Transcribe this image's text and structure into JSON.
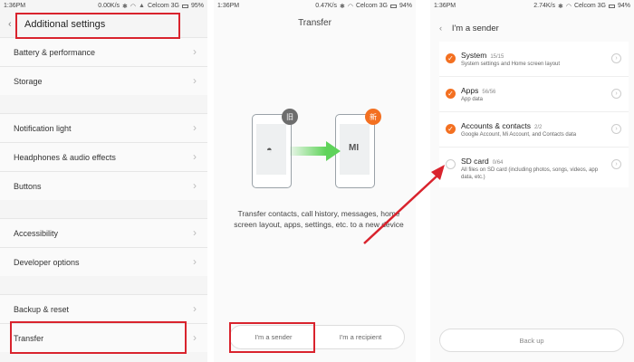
{
  "panel1": {
    "status": {
      "time": "1:36PM",
      "speed": "0.00K/s",
      "carrier": "Celcom 3G",
      "battery": "95%"
    },
    "title": "Additional settings",
    "items": [
      {
        "label": "Battery & performance"
      },
      {
        "label": "Storage"
      },
      {
        "label": "Notification light"
      },
      {
        "label": "Headphones & audio effects"
      },
      {
        "label": "Buttons"
      },
      {
        "label": "Accessibility"
      },
      {
        "label": "Developer options"
      },
      {
        "label": "Backup & reset"
      },
      {
        "label": "Transfer"
      }
    ]
  },
  "panel2": {
    "status": {
      "time": "1:36PM",
      "speed": "0.47K/s",
      "carrier": "Celcom 3G",
      "battery": "94%"
    },
    "title": "Transfer",
    "badge_old": "旧",
    "badge_new": "新",
    "phone_brand": "MI",
    "description": "Transfer contacts, call history, messages, home screen layout, apps, settings, etc. to a new device",
    "sender_label": "I'm a sender",
    "recipient_label": "I'm a recipient"
  },
  "panel3": {
    "status": {
      "time": "1:36PM",
      "speed": "2.74K/s",
      "carrier": "Celcom 3G",
      "battery": "94%"
    },
    "title": "I'm a sender",
    "items": [
      {
        "title": "System",
        "count": "15/15",
        "sub": "System settings and Home screen layout",
        "checked": true
      },
      {
        "title": "Apps",
        "count": "56/56",
        "sub": "App data",
        "checked": true
      },
      {
        "title": "Accounts & contacts",
        "count": "2/2",
        "sub": "Google Account, Mi Account, and Contacts data",
        "checked": true
      },
      {
        "title": "SD card",
        "count": "0/64",
        "sub": "All files on SD card (including photos, songs, videos, app data, etc.)",
        "checked": false
      }
    ],
    "backup_label": "Back up"
  },
  "colors": {
    "accent": "#f37021",
    "annotation": "#d9232d",
    "arrow_green": "#5fd35a"
  },
  "icons": [
    "back-arrow-icon",
    "chevron-right-icon",
    "check-icon",
    "info-icon",
    "android-icon",
    "transfer-arrow-icon"
  ]
}
